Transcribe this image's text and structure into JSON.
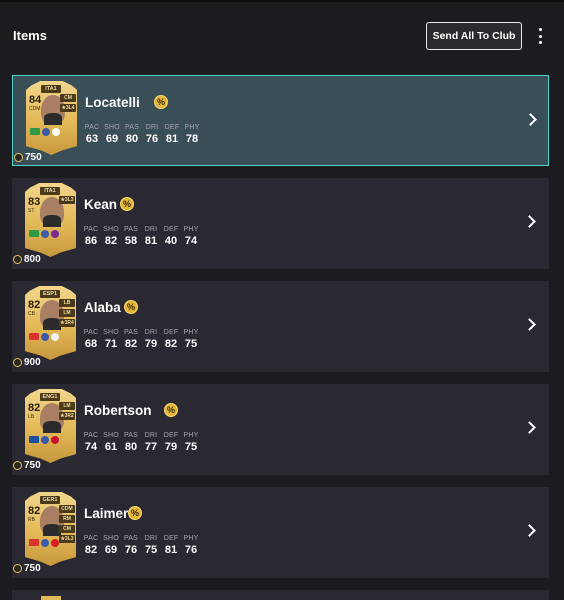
{
  "header": {
    "title": "Items",
    "send_all_label": "Send All To Club"
  },
  "stat_labels": [
    "PAC",
    "SHO",
    "PAS",
    "DRI",
    "DEF",
    "PHY"
  ],
  "colors": {
    "background": "#1b1b20",
    "item_background": "#2a2932",
    "selected_background": "#3a4e57",
    "selected_border": "#4fd4cc",
    "card_gold": "#e3b957",
    "chemistry_gold": "#e5b536"
  },
  "players": [
    {
      "name": "Locatelli",
      "rating": "84",
      "position": "CDM",
      "league": "ITA1",
      "roles": [
        "CM",
        "★3L4"
      ],
      "price": "750",
      "stats": [
        "63",
        "69",
        "80",
        "76",
        "81",
        "78"
      ],
      "selected": true
    },
    {
      "name": "Kean",
      "rating": "83",
      "position": "ST",
      "league": "ITA1",
      "roles": [
        "★3L3"
      ],
      "price": "800",
      "stats": [
        "86",
        "82",
        "58",
        "81",
        "40",
        "74"
      ],
      "selected": false
    },
    {
      "name": "Alaba",
      "rating": "82",
      "position": "CB",
      "league": "ESP1",
      "roles": [
        "LB",
        "LM",
        "★3R4"
      ],
      "price": "900",
      "stats": [
        "68",
        "71",
        "82",
        "79",
        "82",
        "75"
      ],
      "selected": false
    },
    {
      "name": "Robertson",
      "rating": "82",
      "position": "LB",
      "league": "ENG1",
      "roles": [
        "LM",
        "★3R2"
      ],
      "price": "750",
      "stats": [
        "74",
        "61",
        "80",
        "77",
        "79",
        "75"
      ],
      "selected": false
    },
    {
      "name": "Laimer",
      "rating": "82",
      "position": "RB",
      "league": "GER1",
      "roles": [
        "CDM",
        "RM",
        "CM",
        "★3L3"
      ],
      "price": "750",
      "stats": [
        "82",
        "69",
        "76",
        "75",
        "81",
        "76"
      ],
      "selected": false
    }
  ]
}
